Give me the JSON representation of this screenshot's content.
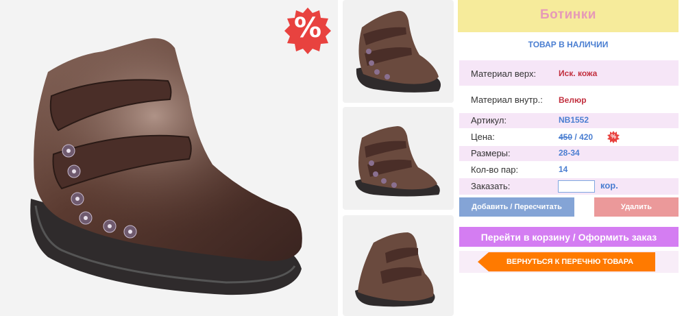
{
  "product": {
    "title": "Ботинки",
    "availability": "ТОВАР В НАЛИЧИИ",
    "sale_symbol": "%"
  },
  "images": {
    "main": "boot-photo",
    "thumbnails": [
      "boot-thumbnail-1",
      "boot-thumbnail-2",
      "boot-thumbnail-3"
    ]
  },
  "specs": {
    "material_top_label": "Материал верх:",
    "material_top_value": "Иск. кожа",
    "material_inner_label": "Материал внутр.:",
    "material_inner_value": "Велюр",
    "article_label": "Артикул:",
    "article_value": "NB1552",
    "price_label": "Цена:",
    "price_old": "450",
    "price_separator": "/",
    "price_new": "420",
    "sizes_label": "Размеры:",
    "sizes_value": "28-34",
    "pairs_label": "Кол-во пар:",
    "pairs_value": "14",
    "order_label": "Заказать:",
    "order_value": "",
    "order_unit": "кор."
  },
  "actions": {
    "add_label": "Добавить / Пересчитать",
    "delete_label": "Удалить",
    "cart_label": "Перейти в корзину / Оформить заказ",
    "back_label": "ВЕРНУТЬСЯ К ПЕРЕЧНЮ ТОВАРА"
  },
  "colors": {
    "title_bg": "#f6eb9b",
    "title_text": "#e699b8",
    "accent_blue": "#4a7ed1",
    "value_red": "#c22f3e",
    "row_pink": "#f6e6f7",
    "add_button": "#84a4d6",
    "delete_button": "#eb999a",
    "cart_button": "#d47df2",
    "back_button": "#ff7a00",
    "sale_badge": "#e8423f"
  }
}
